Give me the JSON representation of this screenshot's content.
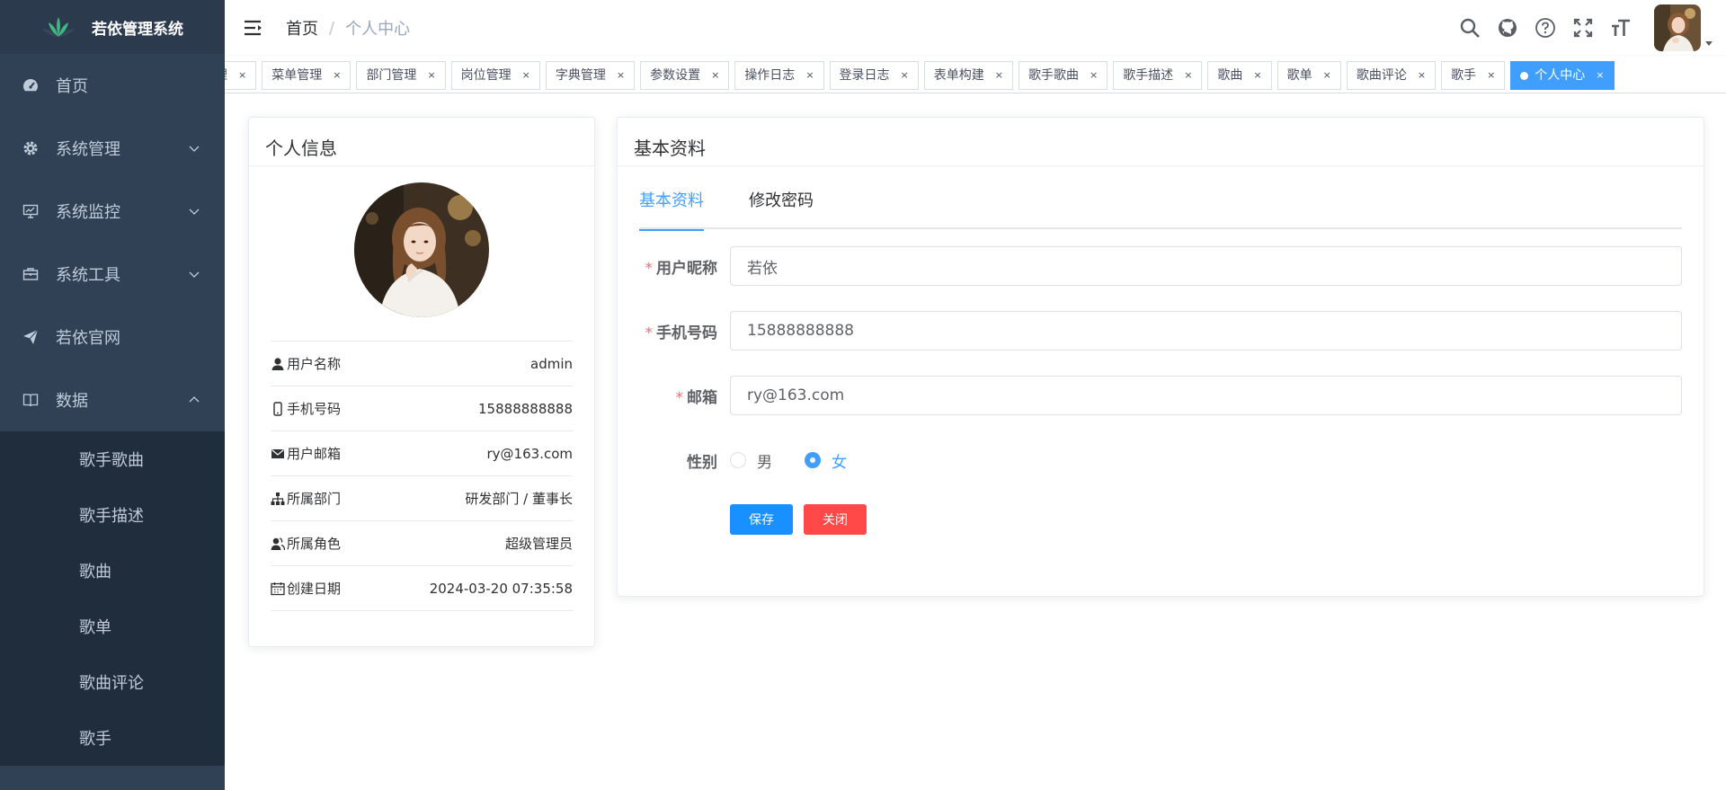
{
  "app": {
    "title": "若依管理系统"
  },
  "sidebar": {
    "items": [
      {
        "label": "首页",
        "icon": "dashboard-icon"
      },
      {
        "label": "系统管理",
        "icon": "gear-icon"
      },
      {
        "label": "系统监控",
        "icon": "monitor-icon"
      },
      {
        "label": "系统工具",
        "icon": "toolbox-icon"
      },
      {
        "label": "若依官网",
        "icon": "send-icon"
      },
      {
        "label": "数据",
        "icon": "book-icon"
      }
    ],
    "submenu": [
      "歌手歌曲",
      "歌手描述",
      "歌曲",
      "歌单",
      "歌曲评论",
      "歌手"
    ]
  },
  "breadcrumb": {
    "home": "首页",
    "sep": "/",
    "current": "个人中心"
  },
  "tags": {
    "items": [
      "理",
      "菜单管理",
      "部门管理",
      "岗位管理",
      "字典管理",
      "参数设置",
      "操作日志",
      "登录日志",
      "表单构建",
      "歌手歌曲",
      "歌手描述",
      "歌曲",
      "歌单",
      "歌曲评论",
      "歌手"
    ],
    "active": "个人中心",
    "close": "×"
  },
  "profile": {
    "title": "个人信息",
    "rows": [
      {
        "label": "用户名称",
        "value": "admin",
        "icon": "user-icon"
      },
      {
        "label": "手机号码",
        "value": "15888888888",
        "icon": "phone-icon"
      },
      {
        "label": "用户邮箱",
        "value": "ry@163.com",
        "icon": "email-icon"
      },
      {
        "label": "所属部门",
        "value": "研发部门 / 董事长",
        "icon": "tree-icon"
      },
      {
        "label": "所属角色",
        "value": "超级管理员",
        "icon": "peoples-icon"
      },
      {
        "label": "创建日期",
        "value": "2024-03-20 07:35:58",
        "icon": "date-icon"
      }
    ]
  },
  "basic": {
    "title": "基本资料",
    "tabs": [
      "基本资料",
      "修改密码"
    ],
    "fields": {
      "nickname": {
        "label": "用户昵称",
        "value": "若依"
      },
      "phone": {
        "label": "手机号码",
        "value": "15888888888"
      },
      "email": {
        "label": "邮箱",
        "value": "ry@163.com"
      }
    },
    "sex": {
      "label": "性别",
      "male": "男",
      "female": "女"
    },
    "save": "保存",
    "close": "关闭"
  },
  "colors": {
    "sidebar": "#304156",
    "submenu": "#1f2d3d",
    "primary": "#409eff",
    "danger": "#ff4949"
  }
}
